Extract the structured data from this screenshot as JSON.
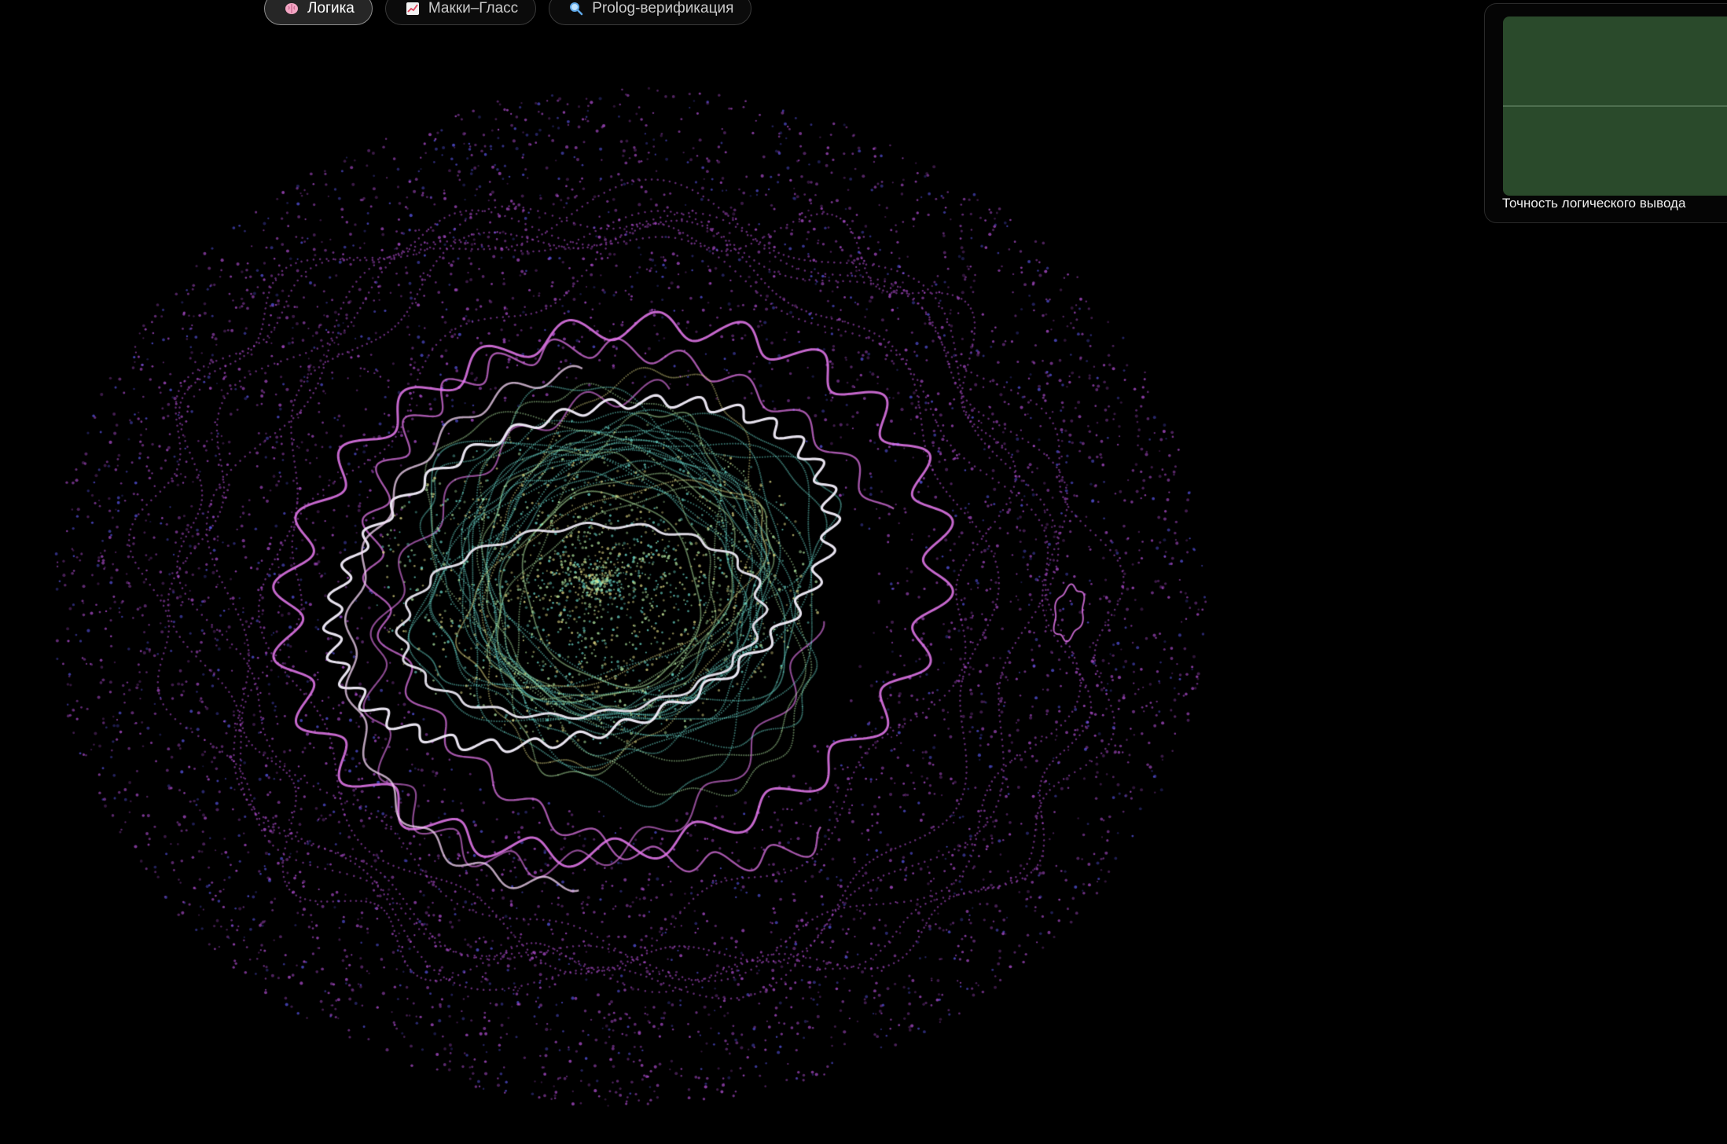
{
  "tabs": [
    {
      "label": "Логика",
      "icon": "brain-icon",
      "active": true
    },
    {
      "label": "Макки–Гласс",
      "icon": "chart-icon",
      "active": false
    },
    {
      "label": "Prolog-верификация",
      "icon": "magnifier-icon",
      "active": false
    }
  ],
  "metric_card": {
    "caption": "Точность логического вывода",
    "plot_color": "#2a4a2b",
    "midline_color": "#4e6f4f"
  },
  "visualization": {
    "background": "#000000",
    "palette": {
      "outer_particles": "#b44fd6",
      "outer_blue": "#5a55e8",
      "magenta_loop": "#e879f0",
      "white_loop": "#f3eefb",
      "inner_cyan": "#6fe3d4",
      "inner_green": "#b8f0a8",
      "inner_yellow": "#e6e08a"
    }
  }
}
